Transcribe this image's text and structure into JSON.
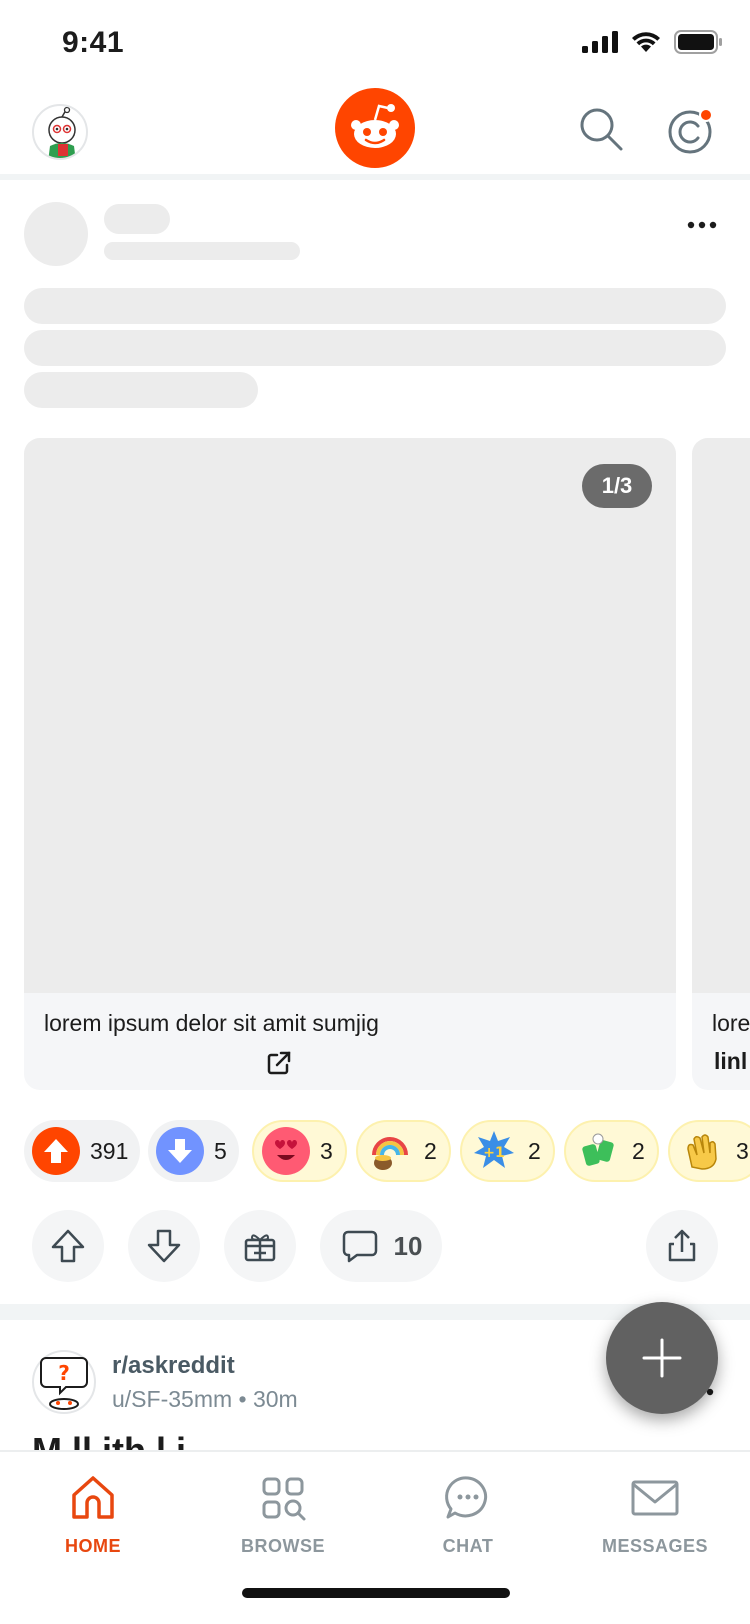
{
  "status_bar": {
    "time": "9:41"
  },
  "post": {
    "gallery": {
      "page_indicator": "1/3",
      "caption": "lorem ipsum delor sit amit sumjig",
      "next_caption_partial": "lore",
      "next_link_partial": "linl"
    },
    "awards": [
      {
        "name": "upvote",
        "count": "391",
        "color": "#ff4500"
      },
      {
        "name": "downvote",
        "count": "5",
        "color": "#7193ff"
      },
      {
        "name": "heart-eyes-award",
        "count": "3"
      },
      {
        "name": "rainbow-award",
        "count": "2"
      },
      {
        "name": "plus-one-award",
        "count": "2"
      },
      {
        "name": "cheers-award",
        "count": "2"
      },
      {
        "name": "clap-award",
        "count": "3"
      }
    ],
    "actions": {
      "comment_count": "10"
    }
  },
  "post2": {
    "subreddit": "r/askreddit",
    "meta": "u/SF-35mm • 30m",
    "title_partial": "M                        ll                    ith l    i"
  },
  "tabs": [
    {
      "label": "HOME",
      "active": true
    },
    {
      "label": "BROWSE",
      "active": false
    },
    {
      "label": "CHAT",
      "active": false
    },
    {
      "label": "MESSAGES",
      "active": false
    }
  ],
  "colors": {
    "brand": "#ff4500",
    "active_tab": "#e8470f",
    "inactive_tab": "#8d979d"
  }
}
